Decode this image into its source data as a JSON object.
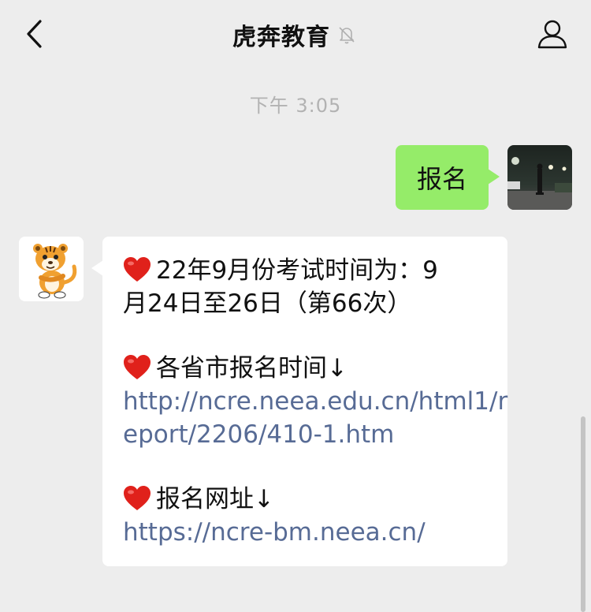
{
  "header": {
    "title": "虎奔教育",
    "back_icon": "chevron-left-icon",
    "mute_icon": "bell-off-icon",
    "profile_icon": "person-icon"
  },
  "timestamp": "下午 3:05",
  "messages": {
    "sent": {
      "text": "报名",
      "bubble_color": "#95ec69"
    },
    "received": {
      "heart_icon": "red-heart-icon",
      "line1": "22年9月份考试时间为：9",
      "line2": "月24日至26日（第66次）",
      "line3": "各省市报名时间↓",
      "link1_line1": "http://ncre.neea.edu.cn/html1/r",
      "link1_line2": "eport/2206/410-1.htm",
      "line4": "报名网址↓",
      "link2": "https://ncre-bm.neea.cn/",
      "link_color": "#576b95"
    }
  },
  "colors": {
    "background": "#ededed",
    "timestamp": "#b2b2b2"
  }
}
